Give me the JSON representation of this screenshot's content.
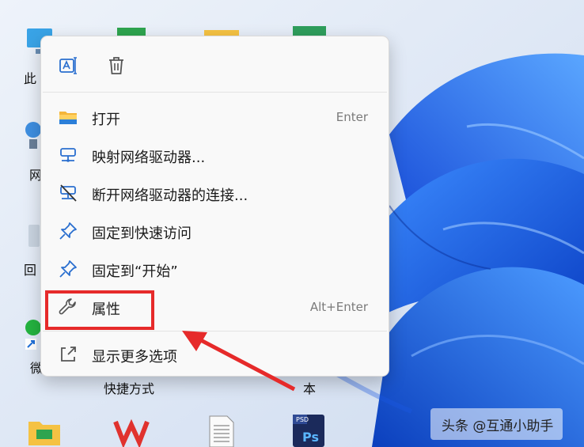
{
  "desktop": {
    "partial_labels": [
      "此",
      "网",
      "回",
      "微",
      "快捷方式",
      "本"
    ]
  },
  "context_menu": {
    "quick_actions": [
      {
        "name": "rename",
        "icon": "rename-icon"
      },
      {
        "name": "delete",
        "icon": "trash-icon"
      }
    ],
    "items": [
      {
        "label": "打开",
        "shortcut": "Enter",
        "icon": "folder-icon"
      },
      {
        "label": "映射网络驱动器...",
        "shortcut": "",
        "icon": "map-network-drive-icon"
      },
      {
        "label": "断开网络驱动器的连接...",
        "shortcut": "",
        "icon": "disconnect-network-drive-icon"
      },
      {
        "label": "固定到快速访问",
        "shortcut": "",
        "icon": "pin-icon"
      },
      {
        "label": "固定到“开始”",
        "shortcut": "",
        "icon": "pin-icon"
      },
      {
        "label": "属性",
        "shortcut": "Alt+Enter",
        "icon": "wrench-icon"
      },
      {
        "label": "显示更多选项",
        "shortcut": "",
        "icon": "share-icon"
      }
    ]
  },
  "annotation": {
    "box_color": "#e62a2a",
    "target": "属性"
  },
  "watermark": {
    "text": "头条 @互通小助手"
  },
  "colors": {
    "wallpaper_blue": "#1a5fe0",
    "menu_bg": "#f9f9f9",
    "icon_blue": "#2a6fcf"
  }
}
